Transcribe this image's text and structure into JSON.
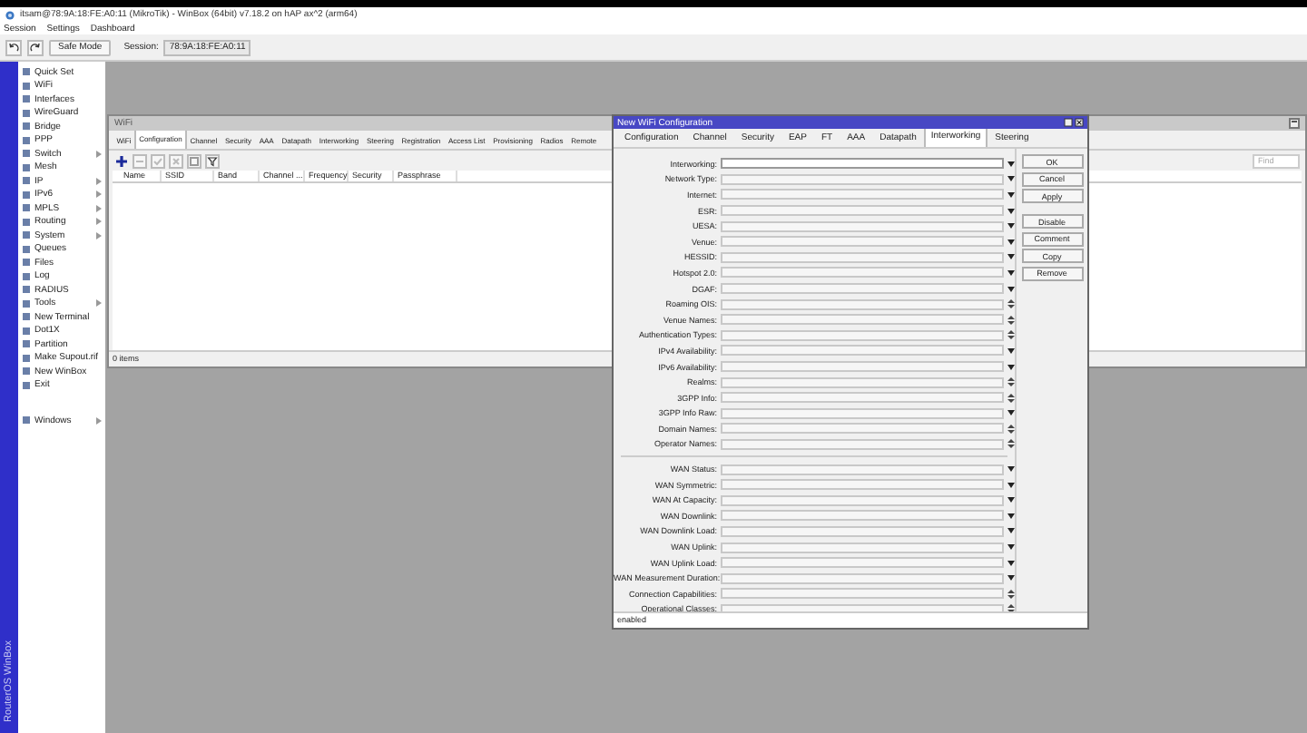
{
  "window": {
    "title": "itsam@78:9A:18:FE:A0:11 (MikroTik) - WinBox (64bit) v7.18.2 on hAP ax^2 (arm64)"
  },
  "menu": [
    "Session",
    "Settings",
    "Dashboard"
  ],
  "toolbar": {
    "safe_mode": "Safe Mode",
    "session_label": "Session:",
    "session_value": "78:9A:18:FE:A0:11"
  },
  "sidebar": {
    "brand": "RouterOS WinBox",
    "items": [
      {
        "label": "Quick Set",
        "submenu": false
      },
      {
        "label": "WiFi",
        "submenu": false
      },
      {
        "label": "Interfaces",
        "submenu": false
      },
      {
        "label": "WireGuard",
        "submenu": false
      },
      {
        "label": "Bridge",
        "submenu": false
      },
      {
        "label": "PPP",
        "submenu": false
      },
      {
        "label": "Switch",
        "submenu": true
      },
      {
        "label": "Mesh",
        "submenu": false
      },
      {
        "label": "IP",
        "submenu": true
      },
      {
        "label": "IPv6",
        "submenu": true
      },
      {
        "label": "MPLS",
        "submenu": true
      },
      {
        "label": "Routing",
        "submenu": true
      },
      {
        "label": "System",
        "submenu": true
      },
      {
        "label": "Queues",
        "submenu": false
      },
      {
        "label": "Files",
        "submenu": false
      },
      {
        "label": "Log",
        "submenu": false
      },
      {
        "label": "RADIUS",
        "submenu": false
      },
      {
        "label": "Tools",
        "submenu": true
      },
      {
        "label": "New Terminal",
        "submenu": false
      },
      {
        "label": "Dot1X",
        "submenu": false
      },
      {
        "label": "Partition",
        "submenu": false
      },
      {
        "label": "Make Supout.rif",
        "submenu": false
      },
      {
        "label": "New WinBox",
        "submenu": false
      },
      {
        "label": "Exit",
        "submenu": false
      }
    ],
    "bottom_items": [
      {
        "label": "Windows",
        "submenu": true
      }
    ]
  },
  "wifi_window": {
    "title": "WiFi",
    "tabs": [
      {
        "label": "WiFi",
        "selected": false
      },
      {
        "label": "Configuration",
        "selected": true
      },
      {
        "label": "Channel",
        "selected": false
      },
      {
        "label": "Security",
        "selected": false
      },
      {
        "label": "AAA",
        "selected": false
      },
      {
        "label": "Datapath",
        "selected": false
      },
      {
        "label": "Interworking",
        "selected": false
      },
      {
        "label": "Steering",
        "selected": false
      },
      {
        "label": "Registration",
        "selected": false
      },
      {
        "label": "Access List",
        "selected": false
      },
      {
        "label": "Provisioning",
        "selected": false
      },
      {
        "label": "Radios",
        "selected": false
      },
      {
        "label": "Remote",
        "selected": false
      }
    ],
    "find": {
      "placeholder": "Find"
    },
    "columns": [
      "Name",
      "SSID",
      "Band",
      "Channel ...",
      "Frequency",
      "Security",
      "Passphrase"
    ],
    "status": "0 items"
  },
  "dialog": {
    "title": "New WiFi Configuration",
    "tabs": [
      {
        "label": "Configuration",
        "selected": false
      },
      {
        "label": "Channel",
        "selected": false
      },
      {
        "label": "Security",
        "selected": false
      },
      {
        "label": "EAP",
        "selected": false
      },
      {
        "label": "FT",
        "selected": false
      },
      {
        "label": "AAA",
        "selected": false
      },
      {
        "label": "Datapath",
        "selected": false
      },
      {
        "label": "Interworking",
        "selected": true
      },
      {
        "label": "Steering",
        "selected": false
      }
    ],
    "sections": [
      [
        {
          "label": "Interworking:",
          "kind": "dropdown"
        },
        {
          "label": "Network Type:",
          "kind": "dropdown"
        },
        {
          "label": "Internet:",
          "kind": "dropdown"
        },
        {
          "label": "ESR:",
          "kind": "dropdown"
        },
        {
          "label": "UESA:",
          "kind": "dropdown"
        },
        {
          "label": "Venue:",
          "kind": "dropdown"
        },
        {
          "label": "HESSID:",
          "kind": "dropdown"
        },
        {
          "label": "Hotspot 2.0:",
          "kind": "dropdown"
        },
        {
          "label": "DGAF:",
          "kind": "dropdown"
        },
        {
          "label": "Roaming OIS:",
          "kind": "updown"
        },
        {
          "label": "Venue Names:",
          "kind": "updown"
        },
        {
          "label": "Authentication Types:",
          "kind": "updown"
        },
        {
          "label": "IPv4 Availability:",
          "kind": "dropdown"
        },
        {
          "label": "IPv6 Availability:",
          "kind": "dropdown"
        },
        {
          "label": "Realms:",
          "kind": "updown"
        },
        {
          "label": "3GPP Info:",
          "kind": "updown"
        },
        {
          "label": "3GPP Info Raw:",
          "kind": "dropdown"
        },
        {
          "label": "Domain Names:",
          "kind": "updown"
        },
        {
          "label": "Operator Names:",
          "kind": "updown"
        }
      ],
      [
        {
          "label": "WAN Status:",
          "kind": "dropdown"
        },
        {
          "label": "WAN Symmetric:",
          "kind": "dropdown"
        },
        {
          "label": "WAN At Capacity:",
          "kind": "dropdown"
        },
        {
          "label": "WAN Downlink:",
          "kind": "dropdown"
        },
        {
          "label": "WAN Downlink Load:",
          "kind": "dropdown"
        },
        {
          "label": "WAN Uplink:",
          "kind": "dropdown"
        },
        {
          "label": "WAN Uplink Load:",
          "kind": "dropdown"
        },
        {
          "label": "WAN Measurement Duration:",
          "kind": "dropdown"
        },
        {
          "label": "Connection Capabilities:",
          "kind": "updown"
        },
        {
          "label": "Operational Classes:",
          "kind": "updown"
        }
      ]
    ],
    "button_groups": [
      [
        "OK",
        "Cancel",
        "Apply"
      ],
      [
        "Disable",
        "Comment",
        "Copy",
        "Remove"
      ]
    ],
    "status": "enabled"
  }
}
